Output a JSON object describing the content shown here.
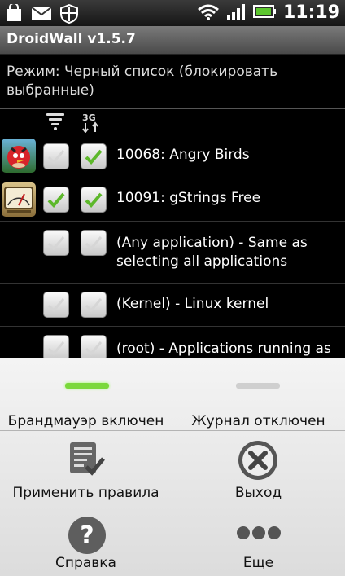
{
  "status_bar": {
    "time": "11:19"
  },
  "title": "DroidWall v1.5.7",
  "mode_text": "Режим: Черный список (блокировать выбранные)",
  "columns": {
    "wifi": "wifi-icon",
    "mobile": "3g-icon"
  },
  "apps": [
    {
      "label": "10068: Angry Birds",
      "wifi": false,
      "mobile": true,
      "icon": "angry-birds-icon"
    },
    {
      "label": "10091: gStrings Free",
      "wifi": true,
      "mobile": true,
      "icon": "gstrings-icon"
    },
    {
      "label": "(Any application) - Same as selecting all applications",
      "wifi": false,
      "mobile": false
    },
    {
      "label": "(Kernel) - Linux kernel",
      "wifi": false,
      "mobile": false
    },
    {
      "label": "(root) - Applications running as root",
      "wifi": false,
      "mobile": false
    }
  ],
  "menu": {
    "firewall": "Брандмауэр включен",
    "log": "Журнал отключен",
    "apply": "Применить правила",
    "exit": "Выход",
    "help": "Справка",
    "more": "Еще"
  },
  "colors": {
    "checked": "#5db82b",
    "firewall_on": "#7ad83a",
    "log_off": "#cccccc"
  }
}
